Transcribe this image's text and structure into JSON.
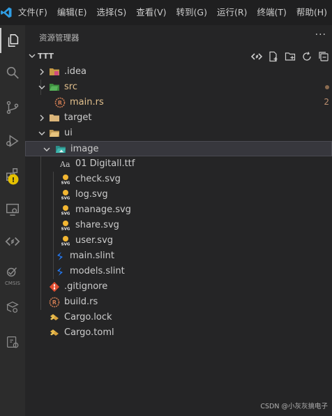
{
  "menubar": {
    "items": [
      "文件(F)",
      "编辑(E)",
      "选择(S)",
      "查看(V)",
      "转到(G)",
      "运行(R)",
      "终端(T)",
      "帮助(H)"
    ]
  },
  "activitybar": {
    "icons": [
      "explorer-icon",
      "search-icon",
      "source-control-icon",
      "run-debug-icon",
      "extensions-icon",
      "remote-explorer-icon",
      "slint-icon",
      "cmsis-icon",
      "device-manager-icon",
      "embedded-tools-icon"
    ],
    "cmsis_label": "CMSIS"
  },
  "sidebar": {
    "title": "资源管理器",
    "more": "···",
    "section": "TTT",
    "section_actions": [
      "new-file-icon",
      "new-folder-icon",
      "refresh-icon",
      "collapse-all-icon"
    ],
    "tree": [
      {
        "name": ".idea",
        "type": "folder",
        "expanded": false,
        "depth": 0,
        "color": "#cccccc"
      },
      {
        "name": "src",
        "type": "folder",
        "expanded": true,
        "depth": 0,
        "color": "#e2c08d",
        "decoration": "dot"
      },
      {
        "name": "main.rs",
        "type": "file",
        "depth": 1,
        "color": "#e2c08d",
        "badge": "2"
      },
      {
        "name": "target",
        "type": "folder",
        "expanded": false,
        "depth": 0,
        "color": "#cccccc"
      },
      {
        "name": "ui",
        "type": "folder",
        "expanded": true,
        "depth": 0,
        "color": "#cccccc"
      },
      {
        "name": "image",
        "type": "folder",
        "expanded": true,
        "depth": 1,
        "color": "#cccccc",
        "selected": true
      },
      {
        "name": "01 Digitall.ttf",
        "type": "file",
        "depth": 2,
        "color": "#cccccc"
      },
      {
        "name": "check.svg",
        "type": "file",
        "depth": 2,
        "color": "#cccccc"
      },
      {
        "name": "log.svg",
        "type": "file",
        "depth": 2,
        "color": "#cccccc"
      },
      {
        "name": "manage.svg",
        "type": "file",
        "depth": 2,
        "color": "#cccccc"
      },
      {
        "name": "share.svg",
        "type": "file",
        "depth": 2,
        "color": "#cccccc"
      },
      {
        "name": "user.svg",
        "type": "file",
        "depth": 2,
        "color": "#cccccc"
      },
      {
        "name": "main.slint",
        "type": "file",
        "depth": 1,
        "color": "#cccccc"
      },
      {
        "name": "models.slint",
        "type": "file",
        "depth": 1,
        "color": "#cccccc"
      },
      {
        "name": ".gitignore",
        "type": "file",
        "depth": 0,
        "color": "#cccccc"
      },
      {
        "name": "build.rs",
        "type": "file",
        "depth": 0,
        "color": "#cccccc"
      },
      {
        "name": "Cargo.lock",
        "type": "file",
        "depth": 0,
        "color": "#cccccc"
      },
      {
        "name": "Cargo.toml",
        "type": "file",
        "depth": 0,
        "color": "#cccccc"
      }
    ]
  },
  "watermark": "CSDN @小灰灰搞电子",
  "colors": {
    "modified": "#e2c08d",
    "accent": "#0078d4",
    "warning": "#e5c100"
  }
}
